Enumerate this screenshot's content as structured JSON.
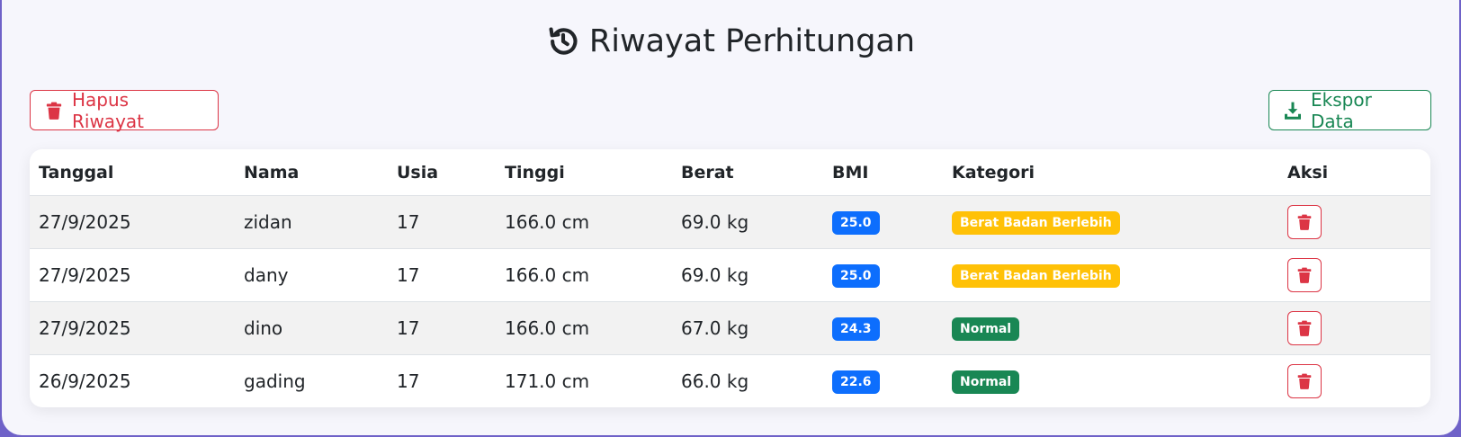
{
  "page": {
    "title": "Riwayat Perhitungan",
    "title_icon": "history-icon"
  },
  "toolbar": {
    "clear_label": "Hapus Riwayat",
    "clear_icon": "trash-icon",
    "export_label": "Ekspor Data",
    "export_icon": "download-icon"
  },
  "table": {
    "headers": [
      "Tanggal",
      "Nama",
      "Usia",
      "Tinggi",
      "Berat",
      "BMI",
      "Kategori",
      "Aksi"
    ],
    "rows": [
      {
        "tanggal": "27/9/2025",
        "nama": "zidan",
        "usia": "17",
        "tinggi": "166.0 cm",
        "berat": "69.0 kg",
        "bmi": "25.0",
        "kategori": "Berat Badan Berlebih"
      },
      {
        "tanggal": "27/9/2025",
        "nama": "dany",
        "usia": "17",
        "tinggi": "166.0 cm",
        "berat": "69.0 kg",
        "bmi": "25.0",
        "kategori": "Berat Badan Berlebih"
      },
      {
        "tanggal": "27/9/2025",
        "nama": "dino",
        "usia": "17",
        "tinggi": "166.0 cm",
        "berat": "67.0 kg",
        "bmi": "24.3",
        "kategori": "Normal"
      },
      {
        "tanggal": "26/9/2025",
        "nama": "gading",
        "usia": "17",
        "tinggi": "171.0 cm",
        "berat": "66.0 kg",
        "bmi": "22.6",
        "kategori": "Normal"
      }
    ],
    "action_icon": "trash-icon"
  },
  "colors": {
    "background": "#6f62c8",
    "danger": "#dc3545",
    "success": "#198754",
    "primary": "#0d6efd",
    "warning": "#ffc107"
  }
}
